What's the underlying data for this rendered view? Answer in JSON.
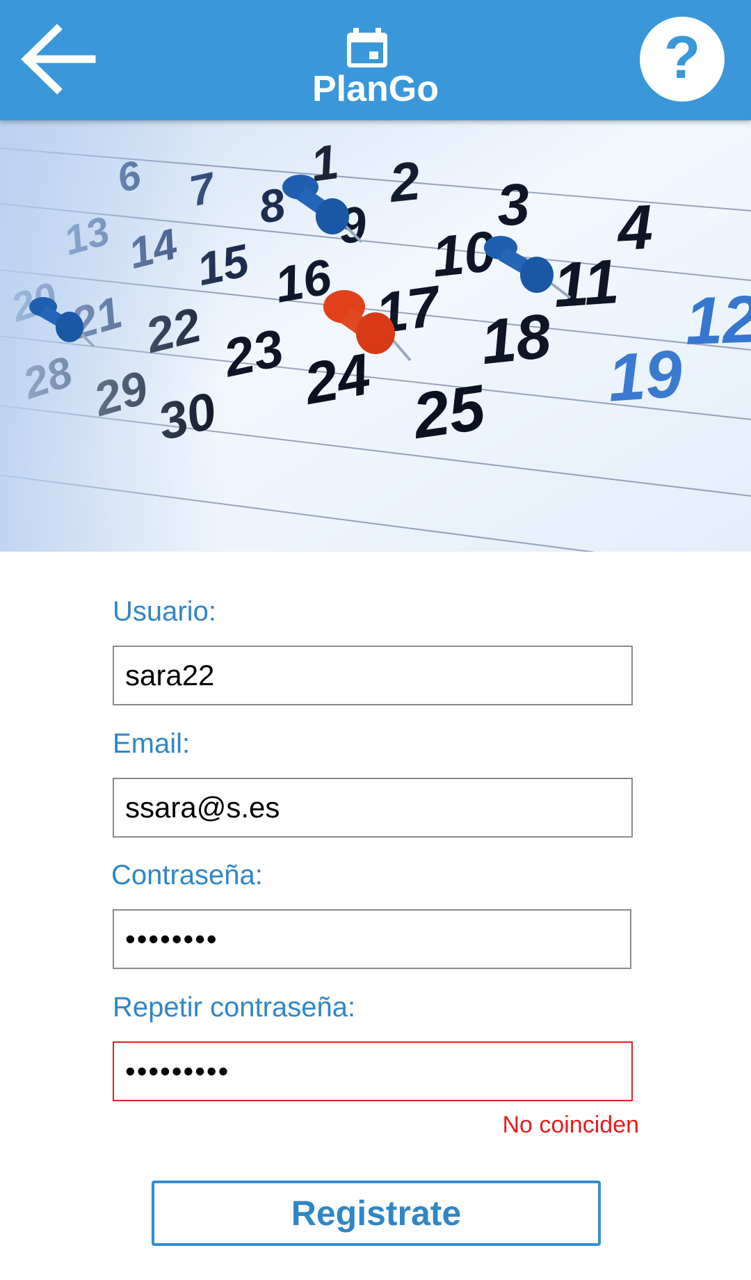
{
  "header": {
    "title": "PlanGo",
    "back_icon": "arrow-left-icon",
    "app_icon": "calendar-icon",
    "help_icon": "help-icon",
    "help_symbol": "?",
    "accent_color": "#3a97da"
  },
  "hero": {
    "image": "calendar-with-pushpins",
    "dates": [
      "1",
      "2",
      "3",
      "4",
      "6",
      "7",
      "8",
      "9",
      "10",
      "11",
      "12",
      "13",
      "14",
      "15",
      "16",
      "17",
      "18",
      "19",
      "20",
      "21",
      "22",
      "23",
      "24",
      "25",
      "28",
      "29",
      "30"
    ]
  },
  "form": {
    "username": {
      "label": "Usuario:",
      "value": "sara22"
    },
    "email": {
      "label": "Email:",
      "value": "ssara@s.es"
    },
    "password": {
      "label": "Contraseña:",
      "value": "••••••••"
    },
    "repeat_password": {
      "label": "Repetir contraseña:",
      "value": "•••••••••",
      "error": "No coinciden"
    },
    "submit_label": "Registrate",
    "label_color": "#2f86c7",
    "error_color": "#e51c1c"
  }
}
